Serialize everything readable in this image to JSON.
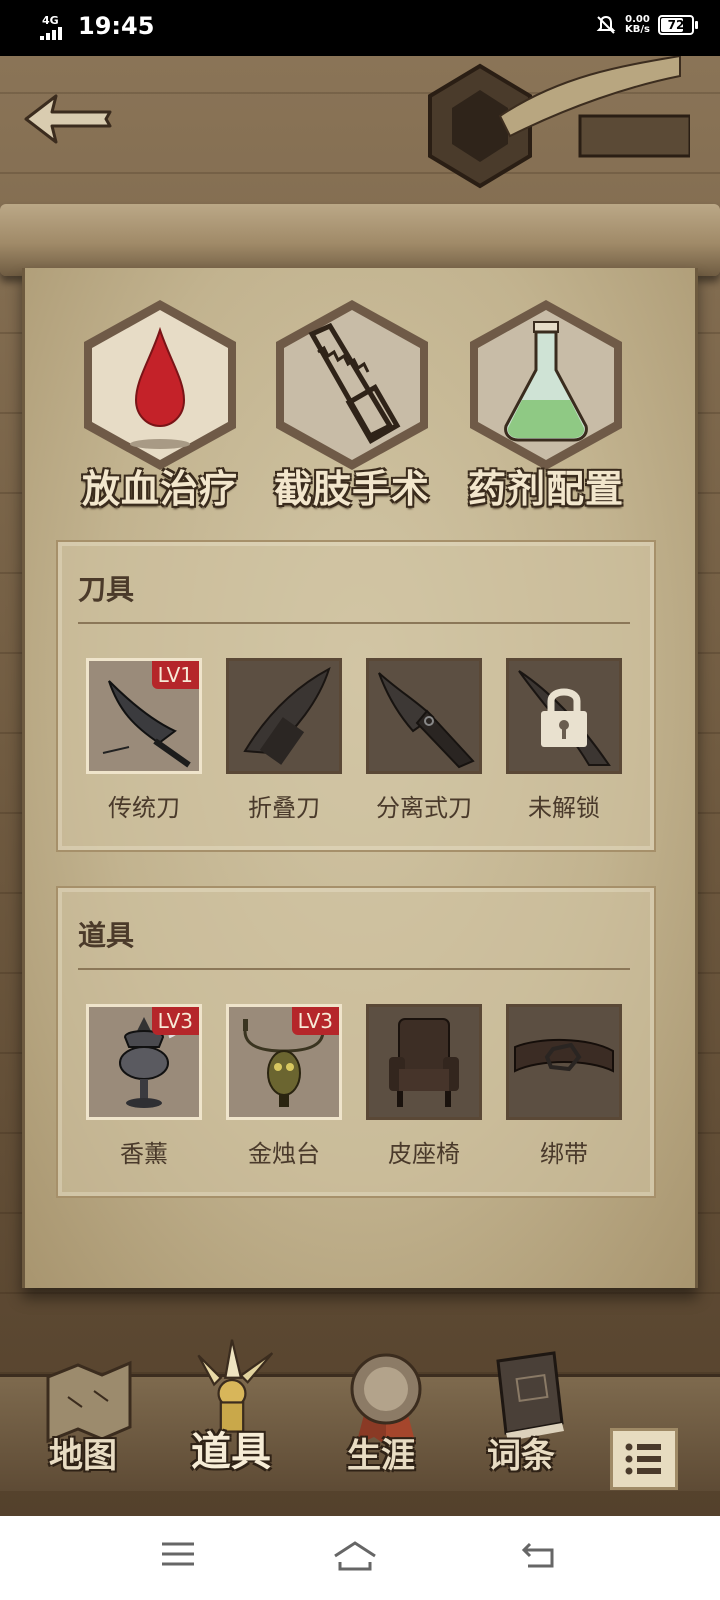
{
  "status_bar": {
    "network": "4G",
    "time": "19:45",
    "speed_value": "0.00",
    "speed_unit": "KB/s",
    "battery": "72"
  },
  "categories": [
    {
      "label": "放血治疗",
      "icon": "blood-drop-icon"
    },
    {
      "label": "截肢手术",
      "icon": "saw-icon"
    },
    {
      "label": "药剂配置",
      "icon": "flask-icon"
    }
  ],
  "knives": {
    "title": "刀具",
    "items": [
      {
        "name": "传统刀",
        "level": "LV1",
        "owned": true,
        "icon": "cleaver-icon"
      },
      {
        "name": "折叠刀",
        "level": "",
        "owned": false,
        "icon": "folding-knife-icon"
      },
      {
        "name": "分离式刀",
        "level": "",
        "owned": false,
        "icon": "split-knife-icon"
      },
      {
        "name": "未解锁",
        "level": "",
        "owned": false,
        "icon": "lock-icon"
      }
    ]
  },
  "props": {
    "title": "道具",
    "items": [
      {
        "name": "香薰",
        "level": "LV3",
        "owned": true,
        "icon": "incense-burner-icon"
      },
      {
        "name": "金烛台",
        "level": "LV3",
        "owned": true,
        "icon": "candelabra-icon"
      },
      {
        "name": "皮座椅",
        "level": "",
        "owned": false,
        "icon": "leather-chair-icon"
      },
      {
        "name": "绑带",
        "level": "",
        "owned": false,
        "icon": "strap-icon"
      }
    ]
  },
  "bottom_nav": [
    {
      "label": "地图",
      "icon": "map-icon"
    },
    {
      "label": "道具",
      "icon": "tools-icon",
      "active": true
    },
    {
      "label": "生涯",
      "icon": "medal-icon"
    },
    {
      "label": "词条",
      "icon": "book-icon"
    }
  ],
  "colors": {
    "parchment": "#c9bb98",
    "level_badge": "#b5262a",
    "ink": "#4a3a2b"
  }
}
